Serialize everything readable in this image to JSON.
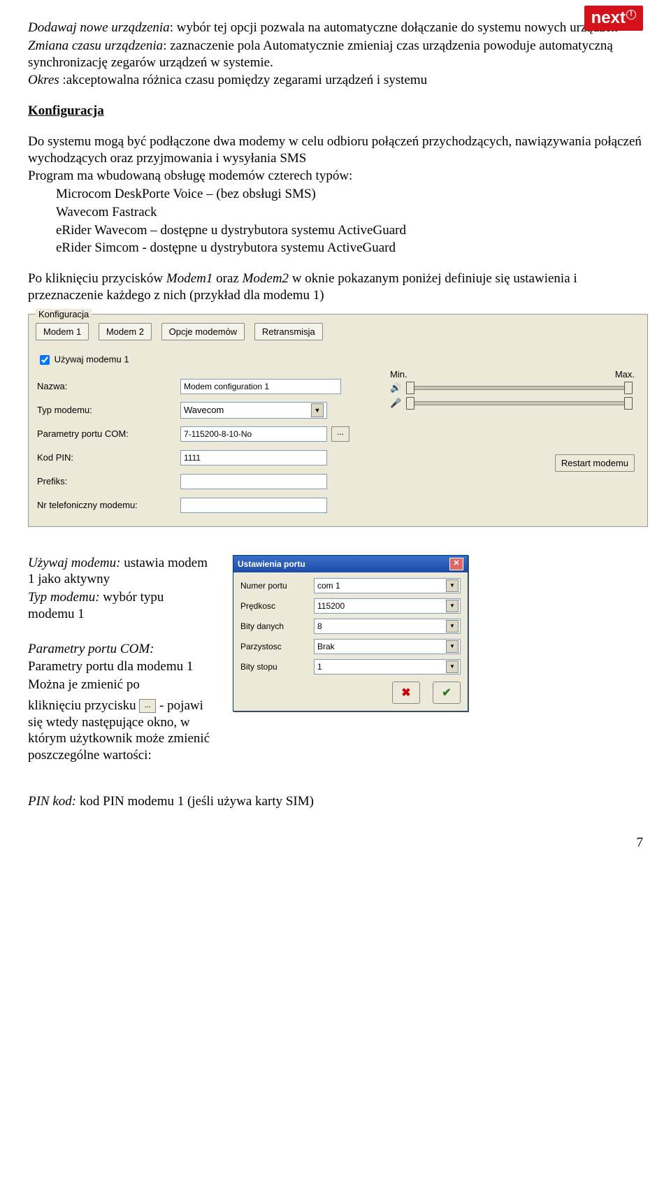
{
  "logo": {
    "text": "next",
    "mark": "!"
  },
  "para1": {
    "t1": "Dodawaj nowe urządzenia",
    "t2": ": wybór tej opcji pozwala na automatyczne dołączanie do systemu nowych urządzeń"
  },
  "para2": {
    "t1": "Zmiana czasu urządzenia",
    "t2": ": zaznaczenie pola Automatycznie zmieniaj czas urządzenia powoduje automatyczną synchronizację zegarów urządzeń w systemie."
  },
  "para3": {
    "t1": "Okres ",
    "t2": ":akceptowalna różnica czasu pomiędzy zegarami urządzeń i systemu"
  },
  "heading1": "Konfiguracja",
  "para4": "Do systemu mogą być podłączone dwa modemy w celu odbioru połączeń przychodzących, nawiązywania połączeń wychodzących oraz przyjmowania i wysyłania SMS",
  "para5": "Program ma wbudowaną obsługę modemów czterech typów:",
  "list": [
    "Microcom DeskPorte Voice – (bez obsługi SMS)",
    "Wavecom Fastrack",
    "eRider Wavecom – dostępne u dystrybutora systemu ActiveGuard",
    "eRider Simcom - dostępne u dystrybutora systemu ActiveGuard"
  ],
  "para6": {
    "a": "Po kliknięciu przycisków ",
    "b": "Modem1",
    "c": " oraz ",
    "d": "Modem2",
    "e": " w oknie pokazanym poniżej definiuje się ustawienia i przeznaczenie każdego z nich (przykład dla modemu 1)"
  },
  "panel": {
    "groupTitle": "Konfiguracja",
    "tabs": [
      "Modem 1",
      "Modem 2",
      "Opcje modemów",
      "Retransmisja"
    ],
    "checkbox": "Używaj modemu 1",
    "labels": {
      "name": "Nazwa:",
      "type": "Typ modemu:",
      "com": "Parametry portu COM:",
      "pin": "Kod PIN:",
      "prefix": "Prefiks:",
      "tel": "Nr telefoniczny modemu:"
    },
    "values": {
      "name": "Modem configuration 1",
      "type": "Wavecom",
      "com": "7-115200-8-10-No",
      "pin": "1111",
      "prefix": "",
      "tel": ""
    },
    "min": "Min.",
    "max": "Max.",
    "restart": "Restart modemu"
  },
  "col": {
    "l1a": "Używaj modemu: ",
    "l1b": "ustawia modem 1 jako aktywny",
    "l2a": "Typ modemu: ",
    "l2b": "wybór typu modemu 1",
    "l3a": "Parametry portu COM:",
    "l3b": "Parametry portu dla modemu 1",
    "l3c": "Można je zmienić po",
    "l3d": "kliknięciu przycisku ",
    "l3e": " - pojawi się wtedy następujące okno, w którym użytkownik może zmienić poszczególne wartości:"
  },
  "portDialog": {
    "title": "Ustawienia portu",
    "rows": {
      "port": {
        "label": "Numer portu",
        "value": "com 1"
      },
      "baud": {
        "label": "Prędkosc",
        "value": "115200"
      },
      "data": {
        "label": "Bity danych",
        "value": "8"
      },
      "parity": {
        "label": "Parzystosc",
        "value": "Brak"
      },
      "stop": {
        "label": "Bity stopu",
        "value": "1"
      }
    }
  },
  "pinLine": {
    "a": "PIN kod:",
    "b": " kod PIN modemu 1 (jeśli używa karty SIM)"
  },
  "pageNumber": "7"
}
